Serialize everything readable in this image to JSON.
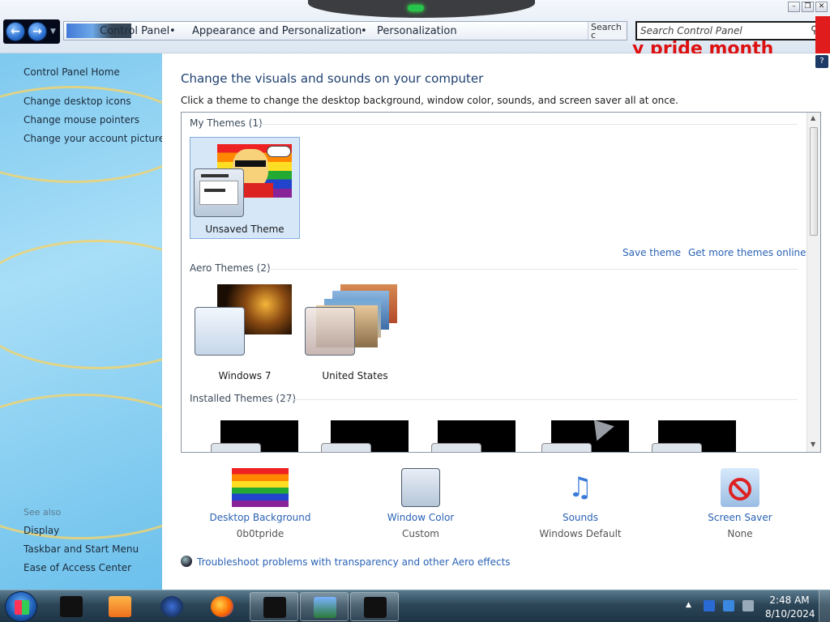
{
  "window": {
    "breadcrumb": [
      "Control Panel",
      "Appearance and Personalization",
      "Personalization"
    ],
    "crumb_sep": "•",
    "addr_fragment": "Search  c",
    "search_placeholder": "Search Control Panel",
    "overlay_text": "y pride month"
  },
  "sidebar": {
    "home": "Control Panel Home",
    "links": [
      "Change desktop icons",
      "Change mouse pointers",
      "Change your account picture"
    ],
    "see_also_label": "See also",
    "see_also": [
      "Display",
      "Taskbar and Start Menu",
      "Ease of Access Center"
    ]
  },
  "main": {
    "title": "Change the visuals and sounds on your computer",
    "subtitle": "Click a theme to change the desktop background, window color, sounds, and screen saver all at once.",
    "groups": {
      "my": "My Themes (1)",
      "aero": "Aero Themes (2)",
      "installed": "Installed Themes (27)"
    },
    "themes": {
      "unsaved": "Unsaved Theme",
      "win7": "Windows 7",
      "us": "United States"
    },
    "save_theme": "Save theme",
    "get_more": "Get more themes online",
    "tiles": [
      {
        "name": "Desktop Background",
        "value": "0b0tpride"
      },
      {
        "name": "Window Color",
        "value": "Custom"
      },
      {
        "name": "Sounds",
        "value": "Windows Default"
      },
      {
        "name": "Screen Saver",
        "value": "None"
      }
    ],
    "troubleshoot": "Troubleshoot problems with transparency and other Aero effects"
  },
  "taskbar": {
    "time": "2:48 AM",
    "date": "8/10/2024"
  },
  "icons": {
    "back": "back-arrow-icon",
    "forward": "forward-arrow-icon",
    "search": "search-icon",
    "sound": "music-notes-icon",
    "saver": "no-sign-icon"
  },
  "colors": {
    "link": "#2a62b4",
    "title": "#1e3f70",
    "pride_red": "#d11"
  }
}
